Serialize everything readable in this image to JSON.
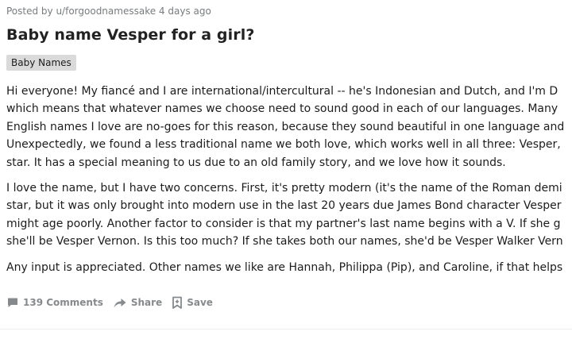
{
  "post": {
    "meta": "Posted by u/forgoodnamessake 4 days ago",
    "title": "Baby name Vesper for a girl?",
    "flair": "Baby Names",
    "paragraphs": [
      [
        "Hi everyone! My fiancé and I are international/intercultural -- he's Indonesian and Dutch, and I'm D",
        "which means that whatever names we choose need to sound good in each of our languages. Many",
        "English names I love are no-goes for this reason, because they sound beautiful in one language and",
        "Unexpectedly, we found a less traditional name we both love, which works well in all three: Vesper,",
        "star. It has a special meaning to us due to an old family story, and we love how it sounds."
      ],
      [
        "I love the name, but I have two concerns. First, it's pretty modern (it's the name of the Roman demi",
        "star, but it was only brought into modern use in the last 20 years due James Bond character Vesper",
        "might age poorly. Another factor to consider is that my partner's last name begins with a V. If she g",
        "she'll be Vesper Vernon. Is this too much? If she takes both our names, she'd be Vesper Walker Vern"
      ],
      [
        "Any input is appreciated. Other names we like are Hannah, Philippa (Pip), and Caroline, if that helps"
      ]
    ]
  },
  "actions": {
    "comments_label": "139 Comments",
    "share_label": "Share",
    "save_label": "Save"
  },
  "icons": {
    "comments": "comment-bubble-icon",
    "share": "share-arrow-icon",
    "save": "bookmark-plus-icon"
  },
  "colors": {
    "text": "#1c1c1c",
    "meta": "#787c7e",
    "flair_bg": "#dadada",
    "action": "#878a8c"
  }
}
